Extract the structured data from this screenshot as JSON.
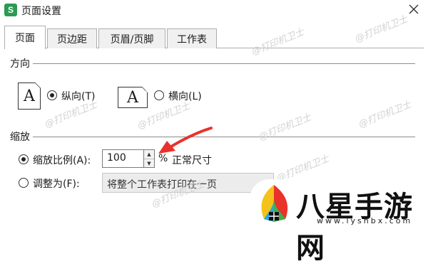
{
  "window": {
    "app_icon_letter": "S",
    "title": "页面设置",
    "close_icon": "close-icon"
  },
  "tabs": [
    {
      "label": "页面",
      "active": true
    },
    {
      "label": "页边距",
      "active": false
    },
    {
      "label": "页眉/页脚",
      "active": false
    },
    {
      "label": "工作表",
      "active": false
    }
  ],
  "orientation": {
    "group_label": "方向",
    "portrait": {
      "icon_letter": "A",
      "label": "纵向(T)",
      "selected": true
    },
    "landscape": {
      "icon_letter": "A",
      "label": "横向(L)",
      "selected": false
    }
  },
  "scaling": {
    "group_label": "缩放",
    "scale_ratio": {
      "label": "缩放比例(A):",
      "value": "100",
      "unit": "%",
      "note": "正常尺寸",
      "selected": true
    },
    "fit_to": {
      "label": "调整为(F):",
      "value": "将整个工作表打印在一页",
      "selected": false
    }
  },
  "watermark_text": "@打印机卫士",
  "brand": {
    "name": "八星手游网",
    "url": "www.lyshbx.com"
  },
  "colors": {
    "app_icon_bg": "#2b9a52",
    "annotation_arrow": "#e8322b"
  }
}
